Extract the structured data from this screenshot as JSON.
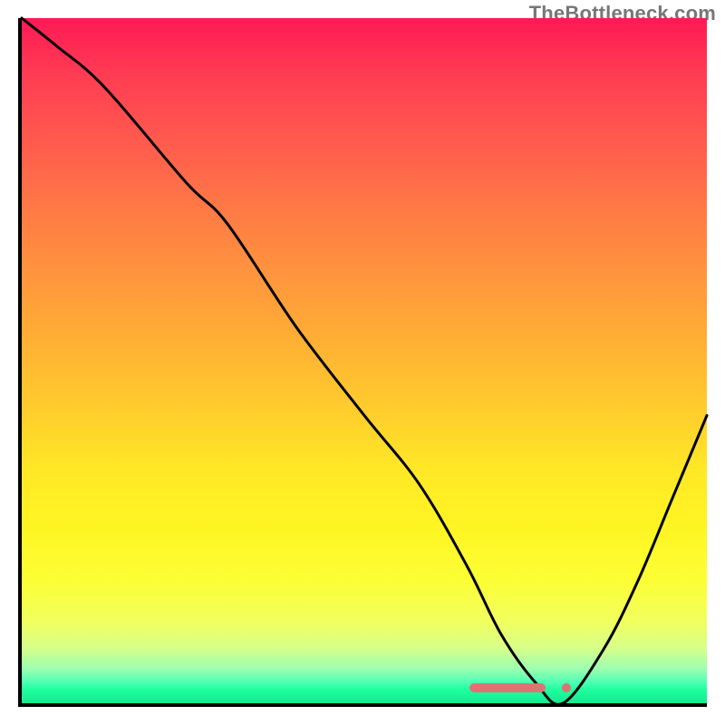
{
  "watermark": "TheBottleneck.com",
  "colors": {
    "axis": "#000000",
    "curve": "#000000",
    "marker": "#dd7373",
    "watermark_text": "#767676",
    "gradient_top": "#ff1955",
    "gradient_bottom": "#16e98e"
  },
  "chart_data": {
    "type": "line",
    "title": "",
    "xlabel": "",
    "ylabel": "",
    "xlim": [
      0,
      100
    ],
    "ylim": [
      0,
      100
    ],
    "grid": false,
    "legend": false,
    "x": [
      0,
      5,
      12,
      24,
      30,
      40,
      50,
      58,
      65,
      70,
      75,
      79,
      85,
      90,
      95,
      100
    ],
    "y": [
      100,
      96,
      90,
      76,
      70,
      55,
      42,
      32,
      20,
      10,
      3,
      0,
      8,
      18,
      30,
      42
    ],
    "annotations": [
      {
        "kind": "valley-marker-bar",
        "x_start": 64,
        "x_end": 75,
        "y": 1.5
      },
      {
        "kind": "valley-marker-dot",
        "x": 78,
        "y": 1.5
      }
    ],
    "background": "vertical-gradient-red-to-green"
  }
}
